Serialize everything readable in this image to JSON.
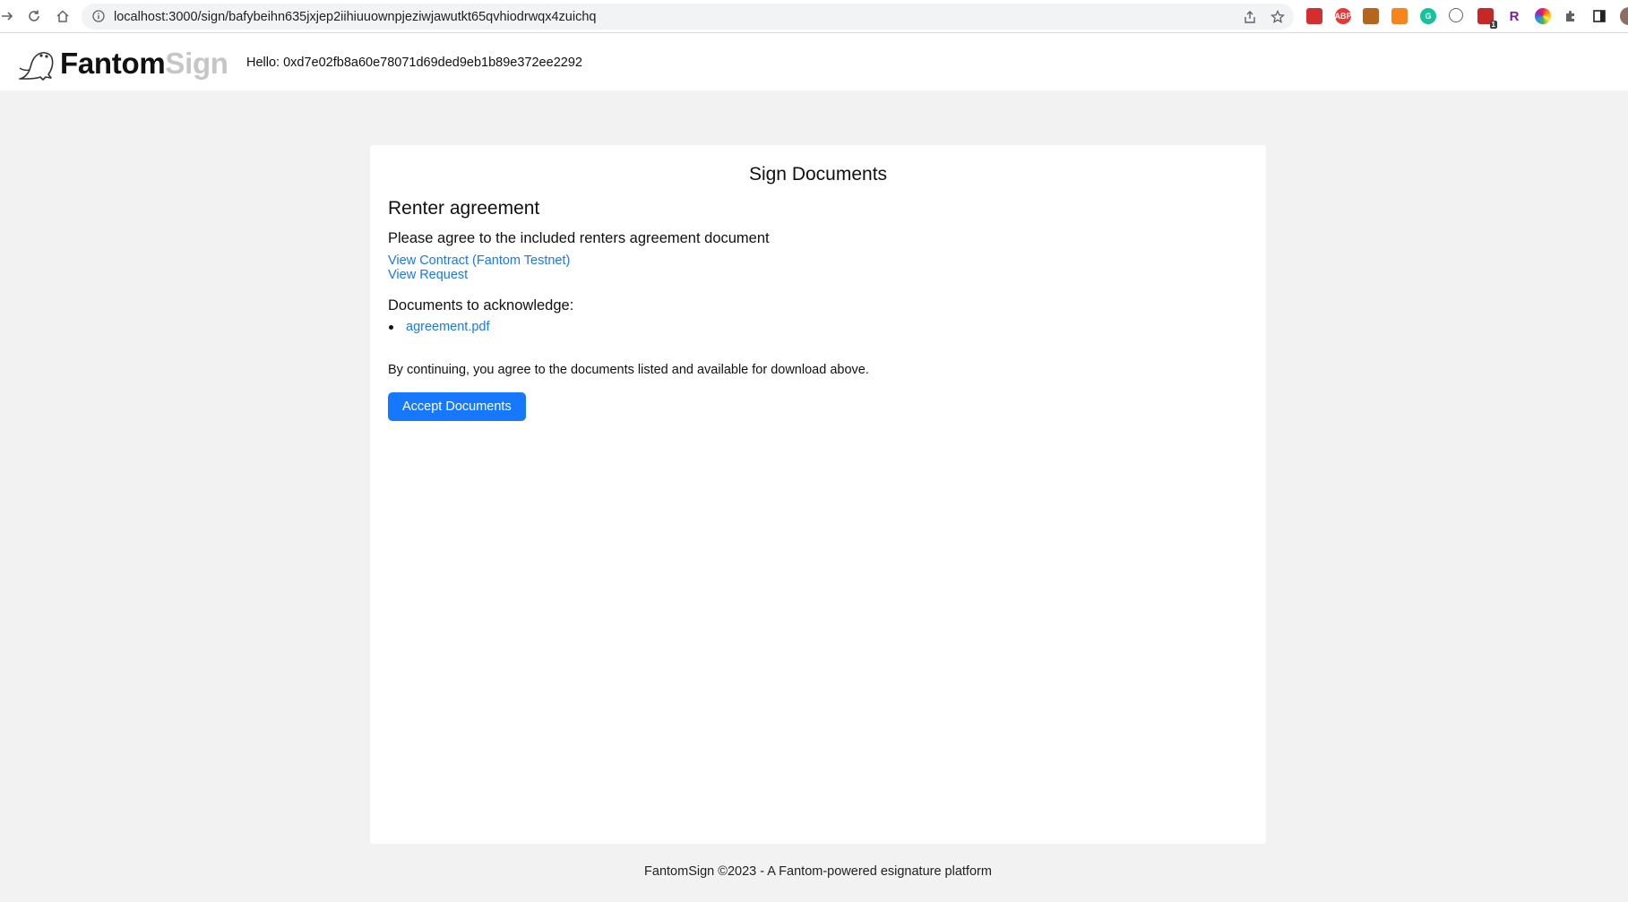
{
  "browser": {
    "url": "localhost:3000/sign/bafybeihn635jxjep2iihiuuownpjeziwjawutkt65qvhiodrwqx4zuichq",
    "extensions": [
      {
        "name": "pdf-icon",
        "label": "",
        "color": "#d32f2f"
      },
      {
        "name": "adblock-plus-icon",
        "label": "ABP",
        "color": "#e53935"
      },
      {
        "name": "extension-brown-icon",
        "label": "",
        "color": "#b5651d"
      },
      {
        "name": "metamask-fox-icon",
        "label": "",
        "color": "#f6851b"
      },
      {
        "name": "grammarly-icon",
        "label": "G",
        "color": "#15c39a"
      },
      {
        "name": "ellipsis-circle-icon",
        "label": "",
        "color": "#5f6368"
      },
      {
        "name": "badge-extension-icon",
        "label": "1",
        "color": "#c62828"
      },
      {
        "name": "r-extension-icon",
        "label": "R",
        "color": "#7b1fa2"
      },
      {
        "name": "color-wheel-icon",
        "label": "",
        "color": "#e91e63"
      }
    ]
  },
  "header": {
    "brand_primary": "Fantom",
    "brand_secondary": "Sign",
    "greeting": "Hello: 0xd7e02fb8a60e78071d69ded9eb1b89e372ee2292"
  },
  "card": {
    "title": "Sign Documents",
    "request_title": "Renter agreement",
    "request_description": "Please agree to the included renters agreement document",
    "view_contract_link": "View Contract (Fantom Testnet)",
    "view_request_link": "View Request",
    "documents_heading": "Documents to acknowledge:",
    "documents": [
      "agreement.pdf"
    ],
    "consent_text": "By continuing, you agree to the documents listed and available for download above.",
    "accept_button": "Accept Documents"
  },
  "footer": {
    "text": "FantomSign ©2023 - A Fantom-powered esignature platform"
  },
  "colors": {
    "link": "#1677ff",
    "button": "#1677ff",
    "page_background": "#f2f2f2"
  }
}
